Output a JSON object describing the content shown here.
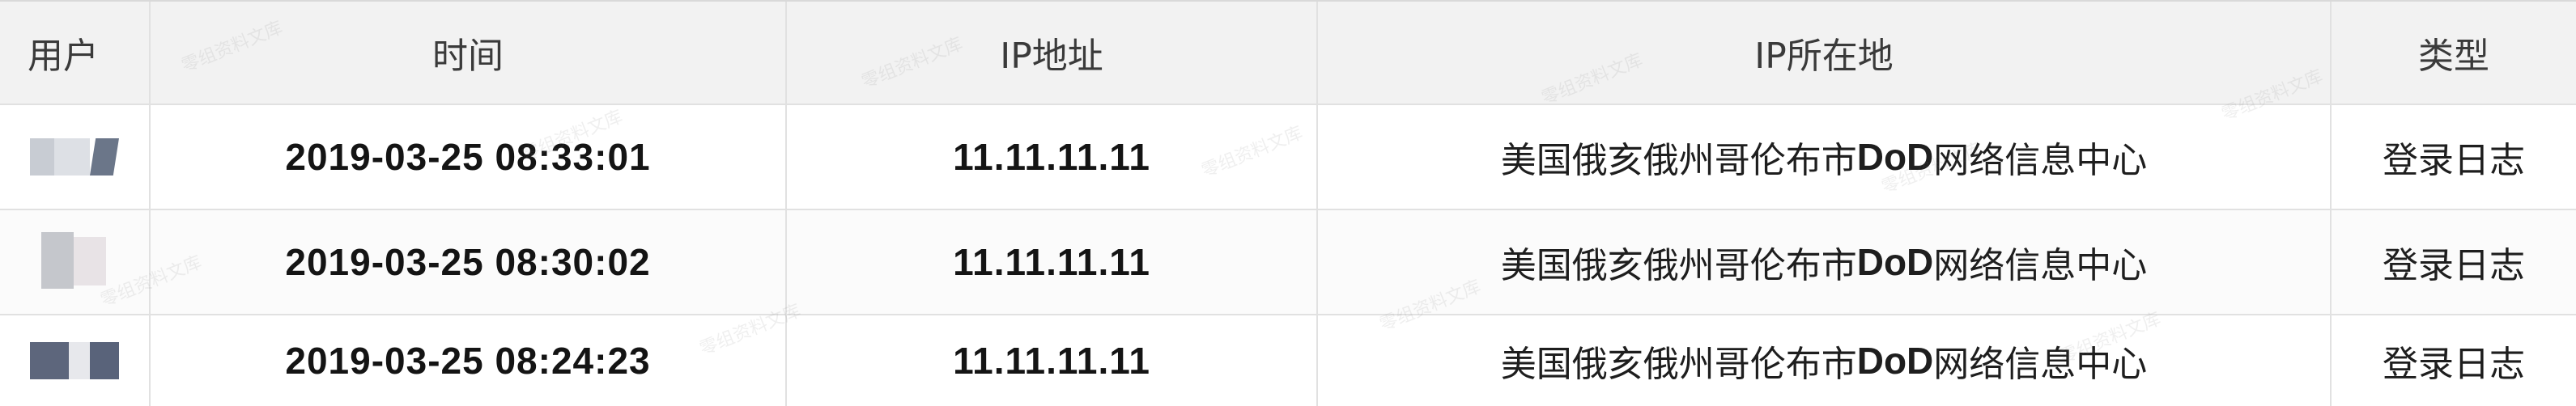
{
  "table": {
    "columns": [
      "用户",
      "时间",
      "IP地址",
      "IP所在地",
      "类型"
    ],
    "rows": [
      {
        "time": "2019-03-25 08:33:01",
        "ip": "11.11.11.11",
        "location_prefix": "美国俄亥俄州哥伦布市",
        "location_org": "DoD",
        "location_suffix": "网络信息中心",
        "type": "登录日志"
      },
      {
        "time": "2019-03-25 08:30:02",
        "ip": "11.11.11.11",
        "location_prefix": "美国俄亥俄州哥伦布市",
        "location_org": "DoD",
        "location_suffix": "网络信息中心",
        "type": "登录日志"
      },
      {
        "time": "2019-03-25 08:24:23",
        "ip": "11.11.11.11",
        "location_prefix": "美国俄亥俄州哥伦布市",
        "location_org": "DoD",
        "location_suffix": "网络信息中心",
        "type": "登录日志"
      }
    ]
  },
  "watermark": {
    "text": "零组资料文库"
  }
}
